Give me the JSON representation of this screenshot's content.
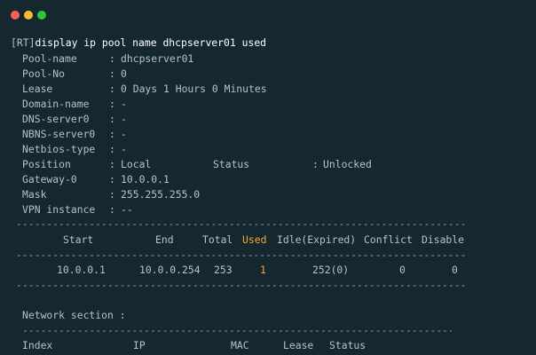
{
  "window": {
    "controls": [
      "close",
      "minimize",
      "maximize"
    ],
    "colors": {
      "close": "#ff5f57",
      "minimize": "#febc2e",
      "maximize": "#28c840"
    }
  },
  "command": {
    "prompt": "[RT]",
    "text": "display ip pool name dhcpserver01 used"
  },
  "pool_info": [
    {
      "key": "Pool-name",
      "value": "dhcpserver01"
    },
    {
      "key": "Pool-No",
      "value": "0"
    },
    {
      "key": "Lease",
      "value": "0 Days 1 Hours 0 Minutes"
    },
    {
      "key": "Domain-name",
      "value": "-"
    },
    {
      "key": "DNS-server0",
      "value": "-"
    },
    {
      "key": "NBNS-server0",
      "value": "-"
    },
    {
      "key": "Netbios-type",
      "value": "-"
    },
    {
      "key": "Position",
      "value": "Local",
      "extra_key": "Status",
      "extra_value": "Unlocked"
    },
    {
      "key": "Gateway-0",
      "value": "10.0.0.1"
    },
    {
      "key": "Mask",
      "value": "255.255.255.0"
    },
    {
      "key": "VPN instance",
      "value": "--"
    }
  ],
  "separator": ":",
  "rule_text": "--------------------------------------------------------------------------",
  "short_rule_text": "--------------------------------------------------------------------------",
  "table": {
    "headers": [
      "Start",
      "End",
      "Total",
      "Used",
      "Idle(Expired)",
      "Conflict",
      "Disable"
    ],
    "highlight_column": "Used",
    "highlight_color": "#f6a623",
    "rows": [
      [
        "10.0.0.1",
        "10.0.0.254",
        "253",
        "1",
        "252(0)",
        "0",
        "0"
      ]
    ]
  },
  "network_section": {
    "title": "Network section :",
    "headers": [
      "Index",
      "IP",
      "MAC",
      "Lease",
      "Status"
    ]
  }
}
